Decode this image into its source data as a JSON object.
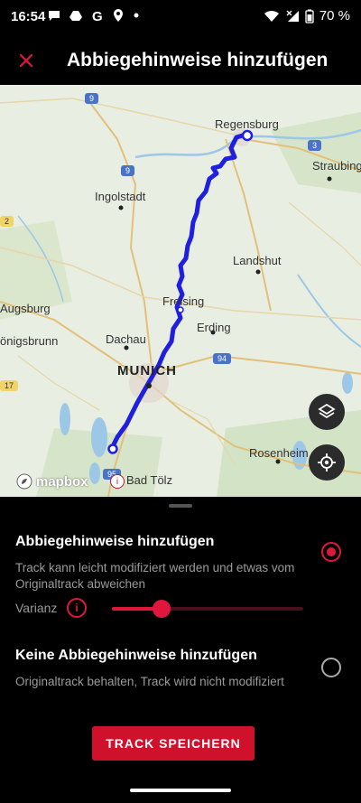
{
  "status_bar": {
    "time": "16:54",
    "battery": "70 %",
    "icons": [
      "message-icon",
      "drive-icon",
      "google-icon",
      "location-icon",
      "dot-icon",
      "wifi-icon",
      "signal-icon",
      "battery-icon"
    ]
  },
  "app_bar": {
    "title": "Abbiegehinweise hinzufügen",
    "close_icon": "close-icon"
  },
  "map": {
    "labels": {
      "regensburg": "Regensburg",
      "straubing": "Straubing",
      "ingolstadt": "Ingolstadt",
      "landshut": "Landshut",
      "augsburg": "Augsburg",
      "freising": "Freising",
      "erding": "Erding",
      "dachau": "Dachau",
      "munich": "MUNICH",
      "konigsbrunn": "önigsbrunn",
      "rosenheim": "Rosenheim",
      "bad_tolz": "Bad Tölz"
    },
    "road_numbers": {
      "r9a": "9",
      "r9b": "9",
      "r3": "3",
      "r2": "2",
      "r17": "17",
      "r94": "94",
      "r95": "95"
    },
    "attribution": "mapbox",
    "route_color": "#1f1fe0"
  },
  "sheet": {
    "option1": {
      "title": "Abbiegehinweise hinzufügen",
      "description": "Track kann leicht modifiziert werden und etwas vom Originaltrack abweichen",
      "selected": true
    },
    "varianz": {
      "label": "Varianz",
      "info_icon": "info-icon",
      "value_fraction": 0.26
    },
    "option2": {
      "title": "Keine Abbiegehinweise hinzufügen",
      "description": "Originaltrack behalten, Track wird nicht modifiziert",
      "selected": false
    },
    "save_button": "TRACK SPEICHERN"
  },
  "colors": {
    "accent": "#e0173d",
    "button": "#d0112b",
    "background": "#000000"
  }
}
